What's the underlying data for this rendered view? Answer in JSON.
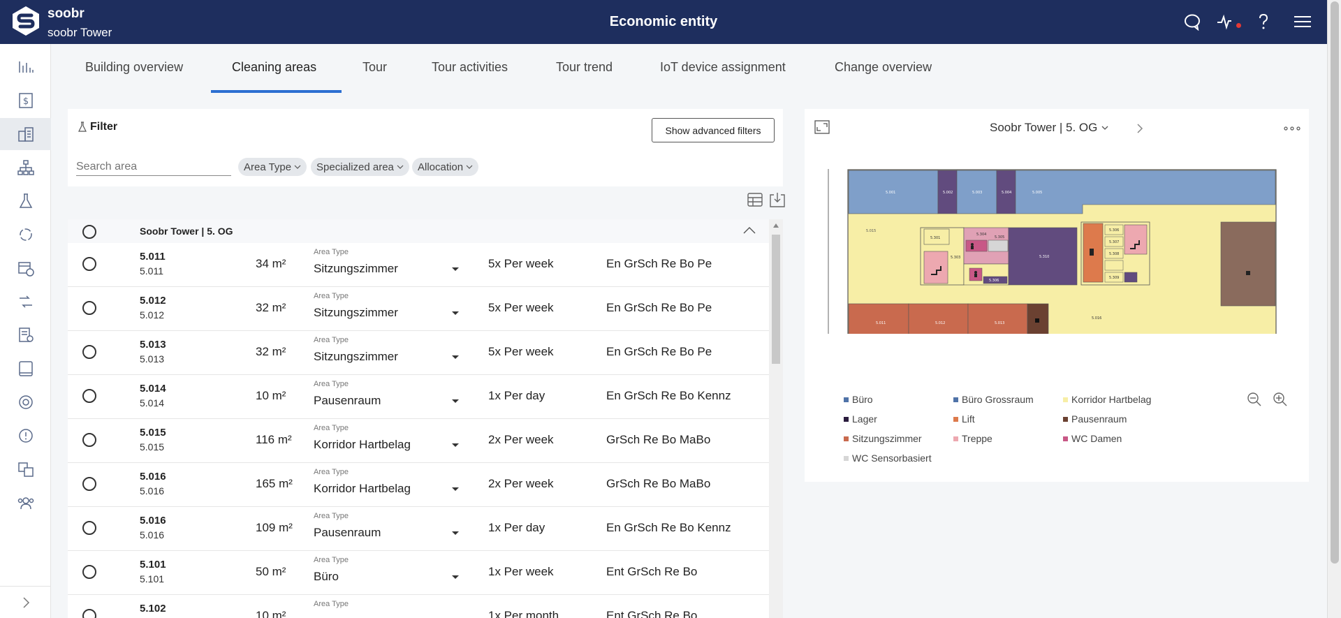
{
  "header": {
    "brand": "soobr",
    "building": "soobr Tower",
    "title": "Economic entity",
    "icons": [
      "chat-icon",
      "activity-icon",
      "help-icon",
      "menu-icon"
    ],
    "accent": "#1e2e5e",
    "alert_color": "#e53935"
  },
  "sidebar": {
    "items": [
      "chart-icon",
      "dollar-icon",
      "building-icon",
      "hierarchy-icon",
      "flask-icon",
      "cycle-icon",
      "calendar-clock-icon",
      "transfer-icon",
      "report-icon",
      "tablet-icon",
      "target-icon",
      "alert-icon",
      "translate-icon",
      "users-icon"
    ],
    "expand_icon": "chevron-right-icon"
  },
  "tabs": [
    {
      "label": "Building overview"
    },
    {
      "label": "Cleaning areas"
    },
    {
      "label": "Tour"
    },
    {
      "label": "Tour activities"
    },
    {
      "label": "Tour trend"
    },
    {
      "label": "IoT device assignment"
    },
    {
      "label": "Change overview"
    }
  ],
  "filter": {
    "title": "Filter",
    "advanced_label": "Show advanced filters",
    "search_placeholder": "Search area",
    "chips": [
      "Area Type",
      "Specialized area",
      "Allocation"
    ]
  },
  "list": {
    "group_label": "Soobr Tower | 5. OG",
    "type_label": "Area Type",
    "rows": [
      {
        "id": "5.011",
        "sub": "5.011",
        "size": "34 m²",
        "type": "Sitzungszimmer",
        "freq": "5x Per week",
        "services": "En GrSch Re Bo Pe"
      },
      {
        "id": "5.012",
        "sub": "5.012",
        "size": "32 m²",
        "type": "Sitzungszimmer",
        "freq": "5x Per week",
        "services": "En GrSch Re Bo Pe"
      },
      {
        "id": "5.013",
        "sub": "5.013",
        "size": "32 m²",
        "type": "Sitzungszimmer",
        "freq": "5x Per week",
        "services": "En GrSch Re Bo Pe"
      },
      {
        "id": "5.014",
        "sub": "5.014",
        "size": "10 m²",
        "type": "Pausenraum",
        "freq": "1x Per day",
        "services": "En GrSch Re Bo Kennz"
      },
      {
        "id": "5.015",
        "sub": "5.015",
        "size": "116 m²",
        "type": "Korridor Hartbelag",
        "freq": "2x Per week",
        "services": "GrSch Re Bo MaBo"
      },
      {
        "id": "5.016",
        "sub": "5.016",
        "size": "165 m²",
        "type": "Korridor Hartbelag",
        "freq": "2x Per week",
        "services": "GrSch Re Bo MaBo"
      },
      {
        "id": "5.016",
        "sub": "5.016",
        "size": "109 m²",
        "type": "Pausenraum",
        "freq": "1x Per day",
        "services": "En GrSch Re Bo Kennz"
      },
      {
        "id": "5.101",
        "sub": "5.101",
        "size": "50 m²",
        "type": "Büro",
        "freq": "1x Per week",
        "services": "Ent GrSch Re Bo"
      },
      {
        "id": "5.102",
        "sub": "",
        "size": "10 m²",
        "type": "",
        "freq": "1x Per month",
        "services": "Ent GrSch Re Bo"
      }
    ]
  },
  "map": {
    "title": "Soobr Tower | 5. OG",
    "room_labels": [
      "5.001",
      "5.002",
      "5.003",
      "5.004",
      "5.005",
      "5.015",
      "5.301",
      "5.303",
      "5.304",
      "5.305",
      "5.306",
      "5.307",
      "5.308",
      "5.309",
      "5.310",
      "5.011",
      "5.012",
      "5.013",
      "5.016"
    ],
    "legend": [
      {
        "label": "Büro",
        "color": "#7f9fc9"
      },
      {
        "label": "Büro Grossraum",
        "color": "#4f73a8"
      },
      {
        "label": "Korridor Hartbelag",
        "color": "#f7eea6"
      },
      {
        "label": "Lager",
        "color": "#2a1c3d"
      },
      {
        "label": "Lift",
        "color": "#dd7a4c"
      },
      {
        "label": "Pausenraum",
        "color": "#6b4131"
      },
      {
        "label": "Sitzungszimmer",
        "color": "#c96a4e"
      },
      {
        "label": "Treppe",
        "color": "#eda8b0"
      },
      {
        "label": "WC Damen",
        "color": "#c85886"
      },
      {
        "label": "WC Sensorbasiert",
        "color": "#d6d6d6"
      }
    ]
  }
}
